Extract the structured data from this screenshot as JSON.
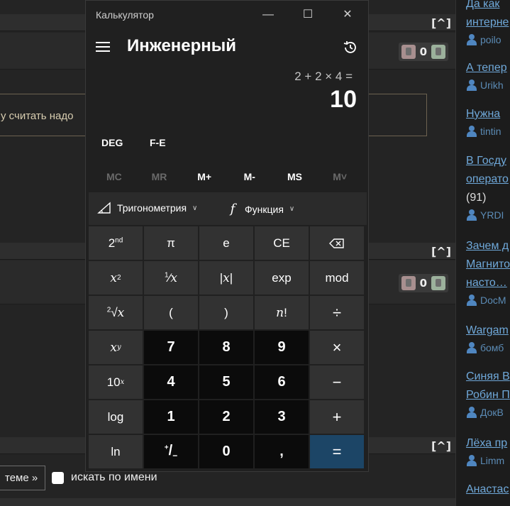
{
  "background": {
    "caret": "[^]",
    "quote_text": "у считать надо",
    "votes": [
      {
        "count": "0"
      },
      {
        "count": "0"
      }
    ],
    "theme_button": "теме »",
    "search_by_name": "искать по имени"
  },
  "sidebar": {
    "items": [
      {
        "title": "Да как",
        "title2": "интерне",
        "user": "poilo"
      },
      {
        "title": "А тепер",
        "user": "Urikh"
      },
      {
        "title": "Нужна",
        "user": "tintin"
      },
      {
        "title": "В Госду",
        "title2": "операто",
        "count": "(91)",
        "user": "YRDI"
      },
      {
        "title": "Зачем д",
        "title2": "Магнито",
        "title3": "насто…",
        "user": "DocM"
      },
      {
        "title": "Wargam",
        "user": "бомб"
      },
      {
        "title": "Синяя В",
        "title2": "Робин П",
        "user": "ДокВ"
      },
      {
        "title": "Лёха пр",
        "user": "Limm"
      },
      {
        "title": "Анастас"
      }
    ]
  },
  "calculator": {
    "window_title": "Калькулятор",
    "mode": "Инженерный",
    "expression": "2 + 2 × 4 =",
    "result": "10",
    "angle_unit": "DEG",
    "fe_label": "F-E",
    "memory": [
      "MC",
      "MR",
      "M+",
      "M-",
      "MS",
      "M˅"
    ],
    "trig_label": "Тригонометрия",
    "func_label": "Функция",
    "keys": {
      "r1": [
        "2nd",
        "π",
        "e",
        "CE",
        "⌫"
      ],
      "r2": [
        "x²",
        "¹⁄x",
        "|x|",
        "exp",
        "mod"
      ],
      "r3": [
        "²√x",
        "(",
        ")",
        "n!",
        "÷"
      ],
      "r4": [
        "xʸ",
        "7",
        "8",
        "9",
        "×"
      ],
      "r5": [
        "10ˣ",
        "4",
        "5",
        "6",
        "−"
      ],
      "r6": [
        "log",
        "1",
        "2",
        "3",
        "+"
      ],
      "r7": [
        "ln",
        "+/₋",
        "0",
        ",",
        "="
      ]
    }
  }
}
